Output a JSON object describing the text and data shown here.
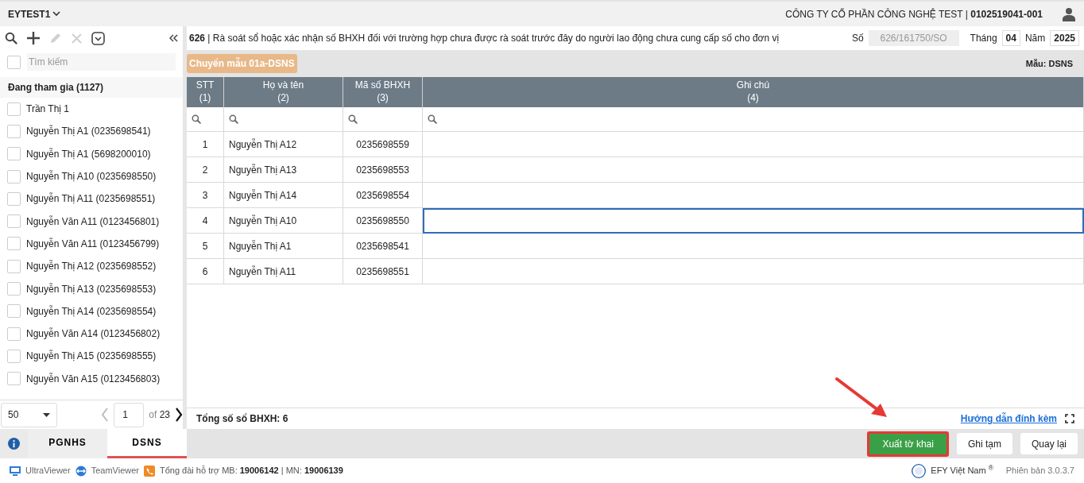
{
  "header": {
    "app": "EYTEST1",
    "company": "CÔNG TY CỔ PHẦN CÔNG NGHỆ TEST | **0102519041-001**"
  },
  "sidebar": {
    "toolbar": [
      {
        "kind": "search",
        "disabled": false
      },
      {
        "kind": "add",
        "disabled": false
      },
      {
        "kind": "edit",
        "disabled": true
      },
      {
        "kind": "delete",
        "disabled": true
      },
      {
        "kind": "dropdown",
        "disabled": false
      }
    ],
    "search": {
      "placeholder": "Tìm kiếm",
      "checked": false
    },
    "group": "Đang tham gia (1127)",
    "items": [
      {
        "label": "Trần Thị 1",
        "checked": false
      },
      {
        "label": "Nguyễn Thị A1 (0235698541)",
        "checked": false
      },
      {
        "label": "Nguyễn Thị A1 (5698200010)",
        "checked": false
      },
      {
        "label": "Nguyễn Thị A10 (0235698550)",
        "checked": false
      },
      {
        "label": "Nguyễn Thị A11 (0235698551)",
        "checked": false
      },
      {
        "label": "Nguyễn Văn A11 (0123456801)",
        "checked": false
      },
      {
        "label": "Nguyễn Văn A11 (0123456799)",
        "checked": false
      },
      {
        "label": "Nguyễn Thị A12 (0235698552)",
        "checked": false
      },
      {
        "label": "Nguyễn Thị A13 (0235698553)",
        "checked": false
      },
      {
        "label": "Nguyễn Thị A14 (0235698554)",
        "checked": false
      },
      {
        "label": "Nguyễn Văn A14 (0123456802)",
        "checked": false
      },
      {
        "label": "Nguyễn Thị A15 (0235698555)",
        "checked": false
      },
      {
        "label": "Nguyễn Văn A15 (0123456803)",
        "checked": false
      }
    ],
    "pager": {
      "page_size": "50",
      "page": "1",
      "of_label": "of",
      "total_pages": "23"
    }
  },
  "form": {
    "title": "**626** | Rà soát sổ hoặc xác nhận số BHXH đối với trường hợp chưa được rà soát trước đây do người lao động chưa cung cấp số cho đơn vị",
    "number_label": "Số",
    "number": "626/161750/SO",
    "month_label": "Tháng",
    "month": "04",
    "year_label": "Năm",
    "year": "2025",
    "convert_button": "Chuyển mẫu 01a-DSNS",
    "template": "Mẫu: DSNS"
  },
  "table": {
    "columns": [
      {
        "title": "STT",
        "index": "(1)"
      },
      {
        "title": "Họ và tên",
        "index": "(2)"
      },
      {
        "title": "Mã số BHXH",
        "index": "(3)"
      },
      {
        "title": "Ghi chú",
        "index": "(4)"
      }
    ],
    "rows": [
      {
        "stt": "1",
        "name": "Nguyễn Thị A12",
        "code": "0235698559",
        "focused": false
      },
      {
        "stt": "2",
        "name": "Nguyễn Thị A13",
        "code": "0235698553",
        "focused": false
      },
      {
        "stt": "3",
        "name": "Nguyễn Thị A14",
        "code": "0235698554",
        "focused": false
      },
      {
        "stt": "4",
        "name": "Nguyễn Thị A10",
        "code": "0235698550",
        "focused": true
      },
      {
        "stt": "5",
        "name": "Nguyễn Thị A1",
        "code": "0235698541",
        "focused": false
      },
      {
        "stt": "6",
        "name": "Nguyễn Thị A11",
        "code": "0235698551",
        "focused": false
      }
    ]
  },
  "summary": "Tổng số sổ BHXH: 6",
  "guide_link": "Hướng dẫn đính kèm",
  "bottom_tabs": [
    {
      "label": "PGNHS",
      "selected": false
    },
    {
      "label": "DSNS",
      "selected": true
    }
  ],
  "actions": [
    {
      "label": "Xuất tờ khai",
      "kind": "primary",
      "highlighted": true
    },
    {
      "label": "Ghi tạm",
      "kind": "secondary",
      "highlighted": false
    },
    {
      "label": "Quay lại",
      "kind": "secondary",
      "highlighted": false
    }
  ],
  "footer": {
    "ultraviewer": "UltraViewer",
    "teamviewer": "TeamViewer",
    "hotline": "Tổng đài hỗ trợ MB: **19006142** | MN: **19006139**",
    "brand": "EFY Việt Nam $^{®}$",
    "version": "Phiên bản 3.0.3.7"
  }
}
